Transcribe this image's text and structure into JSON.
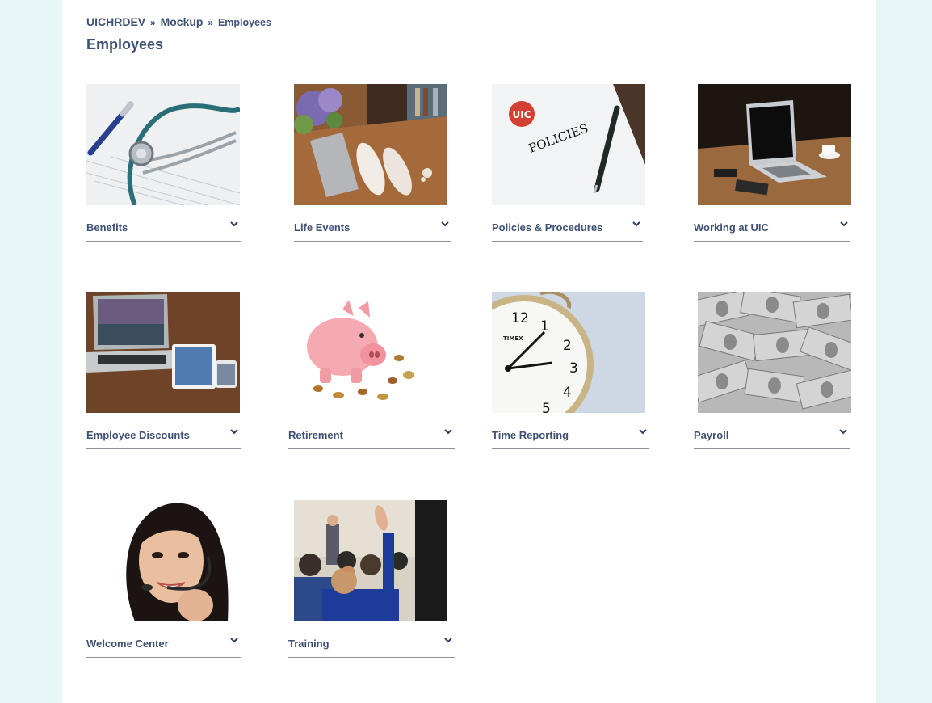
{
  "breadcrumb": {
    "root": "UICHRDEV",
    "sep1": "»",
    "mockup": "Mockup",
    "sep2": "»",
    "current": "Employees"
  },
  "page_title": "Employees",
  "tiles": [
    {
      "label": "Benefits",
      "image": "stethoscope-photo"
    },
    {
      "label": "Life Events",
      "image": "wedding-shoes-photo"
    },
    {
      "label": "Policies & Procedures",
      "image": "policies-document-photo",
      "image_text": {
        "logo": "UIC",
        "word": "POLICIES"
      }
    },
    {
      "label": "Working at UIC",
      "image": "laptop-photo"
    },
    {
      "label": "Employee Discounts",
      "image": "devices-photo"
    },
    {
      "label": "Retirement",
      "image": "piggy-bank-photo"
    },
    {
      "label": "Time Reporting",
      "image": "clock-photo",
      "image_text": {
        "brand": "TIMEX",
        "n12": "12",
        "n1": "1",
        "n2": "2",
        "n3": "3",
        "n4": "4",
        "n5": "5"
      }
    },
    {
      "label": "Payroll",
      "image": "dollar-bills-photo"
    },
    {
      "label": "Welcome Center",
      "image": "headset-agent-photo"
    },
    {
      "label": "Training",
      "image": "classroom-photo"
    }
  ],
  "colors": {
    "background": "#e6f6f6",
    "text": "#3f5275",
    "underline": "#8a8f98"
  },
  "icons": {
    "chevron": "chevron-down-icon"
  }
}
